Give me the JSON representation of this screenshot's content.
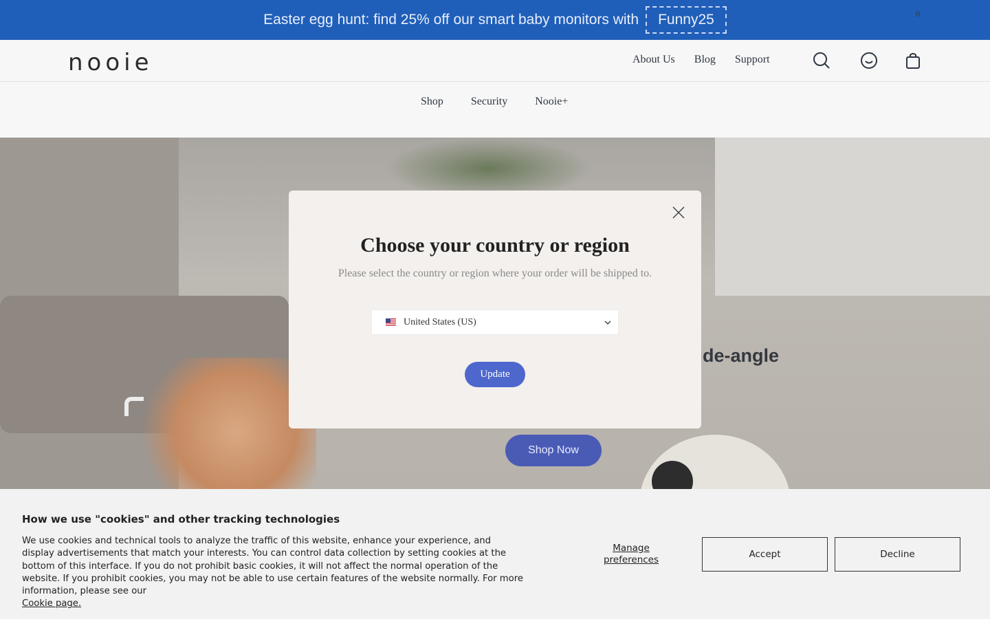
{
  "promo": {
    "text": "Easter egg hunt: find 25% off our smart baby monitors with",
    "code": "Funny25"
  },
  "header": {
    "logo": "nooie",
    "nav": [
      "About Us",
      "Blog",
      "Support"
    ],
    "cart_count": "0"
  },
  "subnav": {
    "items": [
      "Shop",
      "Security",
      "Nooie+"
    ]
  },
  "hero": {
    "headline_visible": "tion tracking with a wide-angle",
    "cta": "Shop Now"
  },
  "modal": {
    "title": "Choose your country or region",
    "subtitle": "Please select the country or region where your order will be shipped to.",
    "selected_country": "United States (US)",
    "update_label": "Update"
  },
  "cookie": {
    "title": "How we use \"cookies\" and other tracking technologies",
    "body": "We use cookies and technical tools to analyze the traffic of this website, enhance your experience, and display advertisements that match your interests. You can control data collection by setting cookies at the bottom of this interface. If you do not prohibit basic cookies, it will not affect the normal operation of the website. If you prohibit cookies, you may not be able to use certain features of the website normally. For more information, please see our",
    "link": "Cookie page.",
    "manage": "Manage preferences",
    "accept": "Accept",
    "decline": "Decline"
  },
  "colors": {
    "promo_bg": "#1f5fb9",
    "accent": "#4e67cc",
    "header_bg": "#f7f7f7",
    "modal_bg": "#f3f0ed",
    "cookie_bg": "#f2f2f2"
  },
  "icons": [
    "search-icon",
    "account-icon",
    "cart-icon",
    "close-icon",
    "chevron-down-icon",
    "us-flag-icon"
  ]
}
